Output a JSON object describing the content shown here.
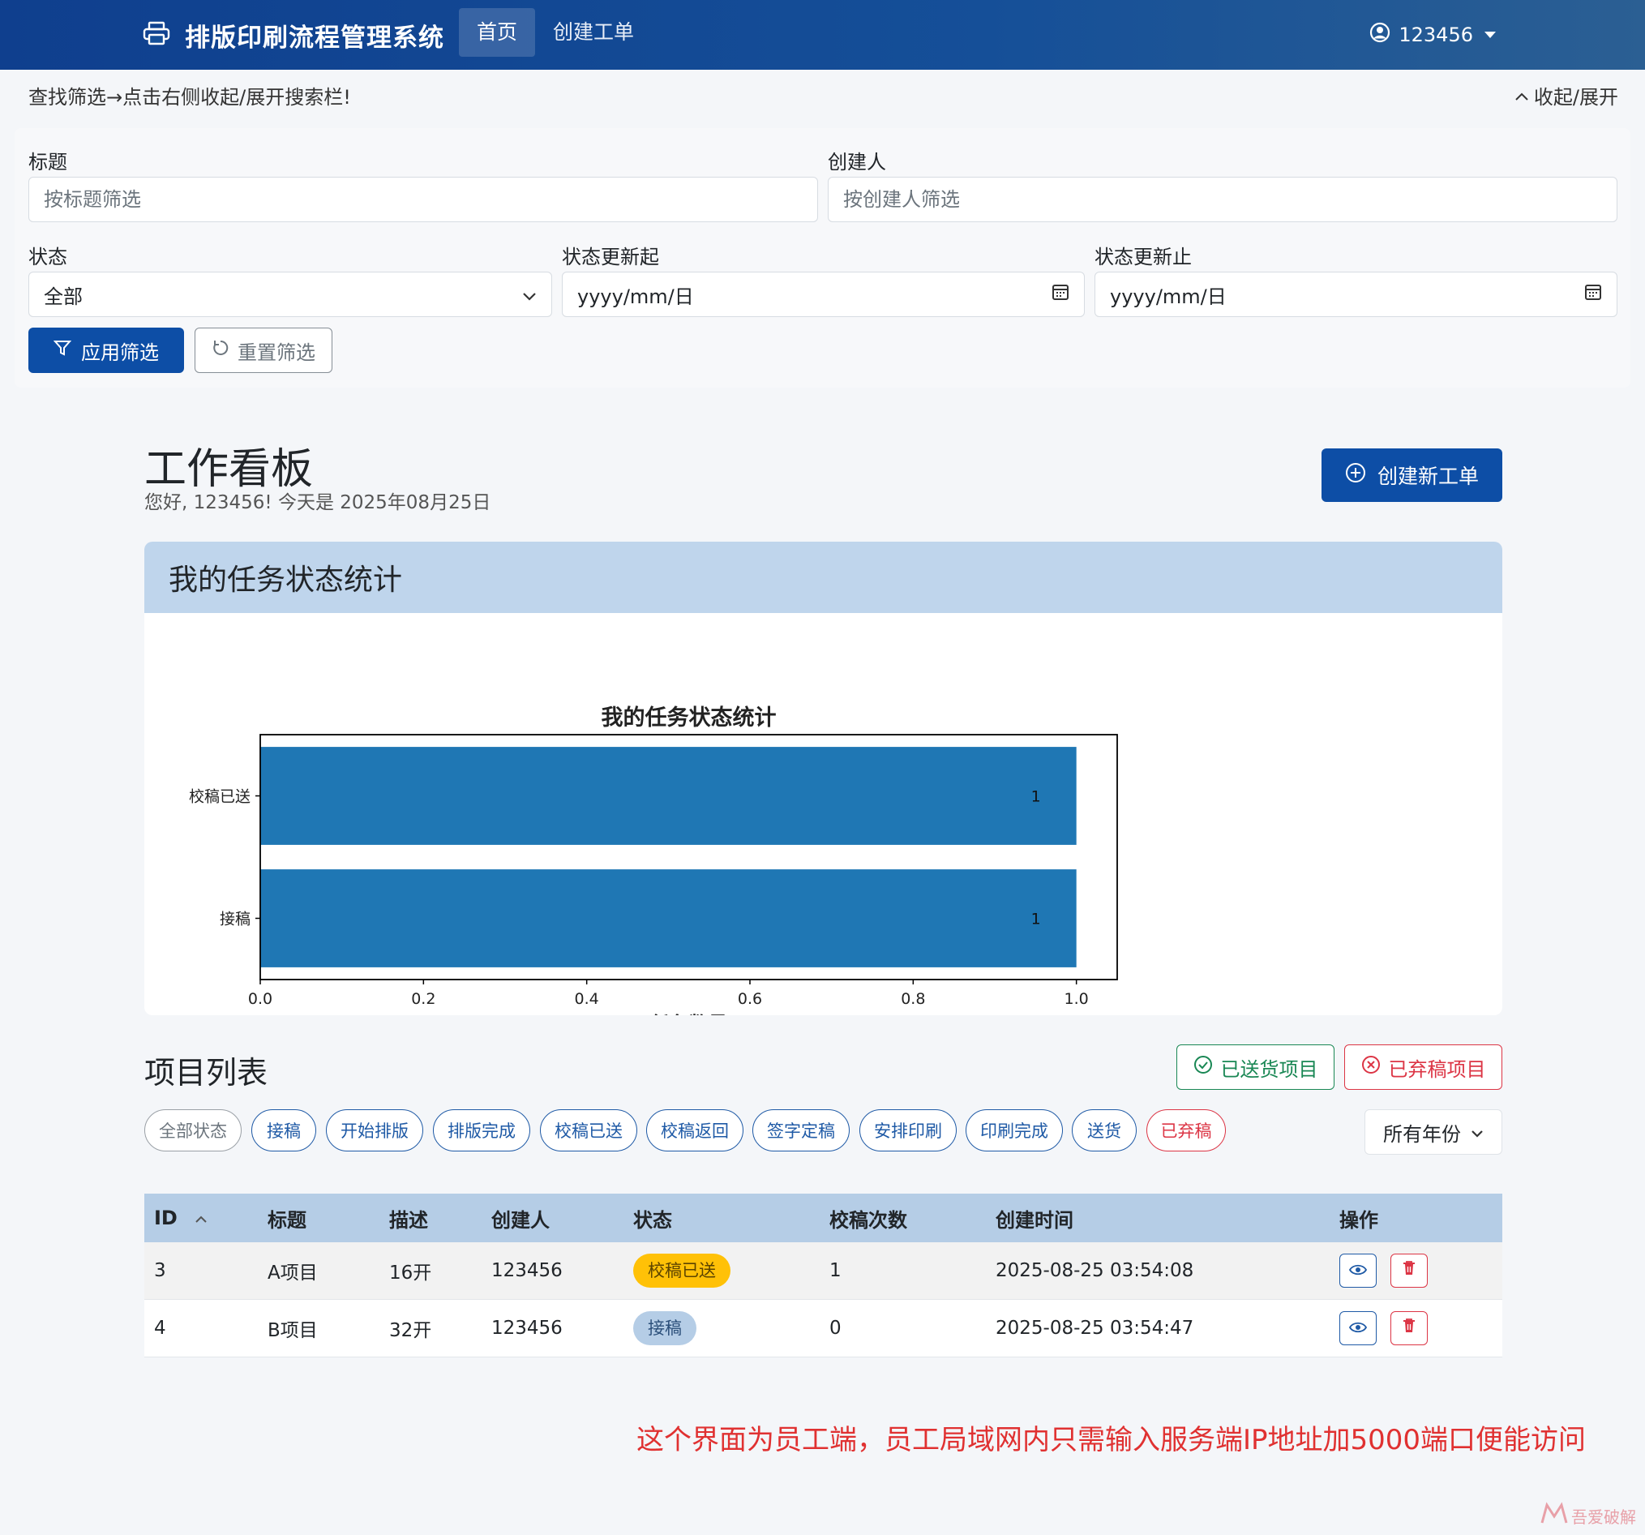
{
  "nav": {
    "title": "排版印刷流程管理系统",
    "links": [
      "首页",
      "创建工单"
    ],
    "user": "123456"
  },
  "filter": {
    "hint": "查找筛选→点击右侧收起/展开搜索栏!",
    "toggle_label": "收起/展开",
    "title_label": "标题",
    "title_placeholder": "按标题筛选",
    "creator_label": "创建人",
    "creator_placeholder": "按创建人筛选",
    "status_label": "状态",
    "status_value": "全部",
    "from_label": "状态更新起",
    "from_placeholder": "yyyy/mm/日",
    "to_label": "状态更新止",
    "to_placeholder": "yyyy/mm/日",
    "apply_label": "应用筛选",
    "reset_label": "重置筛选"
  },
  "dashboard": {
    "title": "工作看板",
    "subtitle": "您好, 123456! 今天是 2025年08月25日",
    "create_label": "创建新工单"
  },
  "stats_card": {
    "header": "我的任务状态统计"
  },
  "chart_data": {
    "type": "bar",
    "orientation": "horizontal",
    "title": "我的任务状态统计",
    "categories": [
      "校稿已送",
      "接稿"
    ],
    "values": [
      1,
      1
    ],
    "data_labels": [
      "1",
      "1"
    ],
    "xlabel": "任务数量",
    "ylabel": "",
    "xlim": [
      0,
      1.05
    ],
    "xticks": [
      "0.0",
      "0.2",
      "0.4",
      "0.6",
      "0.8",
      "1.0"
    ],
    "bar_color": "#1f77b4",
    "grid": false
  },
  "projects": {
    "title": "项目列表",
    "delivered_label": "已送货项目",
    "abandoned_label": "已弃稿项目",
    "status_filters": [
      "全部状态",
      "接稿",
      "开始排版",
      "排版完成",
      "校稿已送",
      "校稿返回",
      "签字定稿",
      "安排印刷",
      "印刷完成",
      "送货",
      "已弃稿"
    ],
    "year_select": "所有年份",
    "columns": [
      "ID",
      "标题",
      "描述",
      "创建人",
      "状态",
      "校稿次数",
      "创建时间",
      "操作"
    ],
    "rows": [
      {
        "id": "3",
        "title": "A项目",
        "desc": "16开",
        "creator": "123456",
        "status": "校稿已送",
        "count": "1",
        "created": "2025-08-25 03:54:08"
      },
      {
        "id": "4",
        "title": "B项目",
        "desc": "32开",
        "creator": "123456",
        "status": "接稿",
        "count": "0",
        "created": "2025-08-25 03:54:47"
      }
    ]
  },
  "footer_note": "这个界面为员工端，员工局域网内只需输入服务端IP地址加5000端口便能访问",
  "watermark": "吾爱破解",
  "colors": {
    "primary": "#0d4ea6",
    "badge_sent": "#ffc107",
    "badge_received": "#b5cde6",
    "danger": "#dc3545",
    "success": "#198754"
  }
}
